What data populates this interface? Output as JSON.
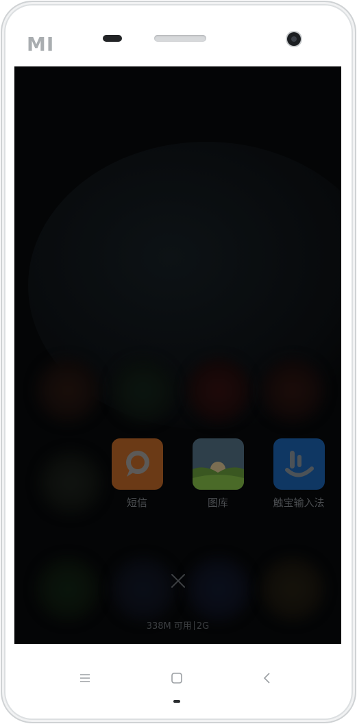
{
  "device": {
    "brand_logo": "MI"
  },
  "recents": {
    "apps": [
      {
        "label": "短信",
        "icon": "message-bubble-icon",
        "color": "#d9772a"
      },
      {
        "label": "图库",
        "icon": "gallery-landscape-icon",
        "color": "#6fae3e"
      },
      {
        "label": "触宝输入法",
        "icon": "touchpal-keyboard-icon",
        "color": "#2a78c9"
      }
    ],
    "close_icon": "close-icon",
    "memory_available": "338M 可用",
    "memory_total": "2G"
  },
  "navbar": {
    "menu_icon": "menu-icon",
    "home_icon": "home-icon",
    "back_icon": "back-icon"
  }
}
